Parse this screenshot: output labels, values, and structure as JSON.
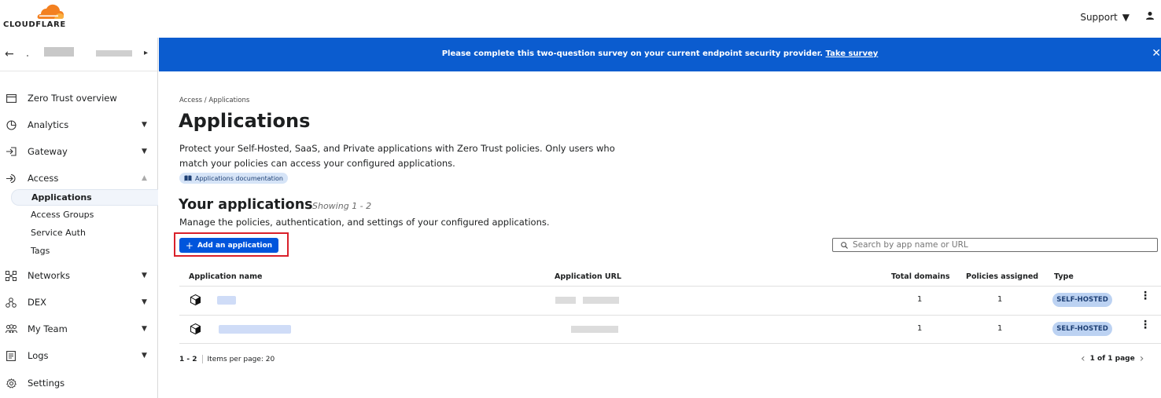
{
  "header": {
    "brand": "CLOUDFLARE",
    "support_label": "Support"
  },
  "sidebar": {
    "items": [
      {
        "label": "Zero Trust overview",
        "icon": "window-icon"
      },
      {
        "label": "Analytics",
        "icon": "pie-chart-icon"
      },
      {
        "label": "Gateway",
        "icon": "gateway-icon"
      },
      {
        "label": "Access",
        "icon": "access-icon"
      },
      {
        "label": "Networks",
        "icon": "network-icon"
      },
      {
        "label": "DEX",
        "icon": "dex-icon"
      },
      {
        "label": "My Team",
        "icon": "team-icon"
      },
      {
        "label": "Logs",
        "icon": "logs-icon"
      },
      {
        "label": "Settings",
        "icon": "gear-icon"
      }
    ],
    "access_subitems": [
      "Applications",
      "Access Groups",
      "Service Auth",
      "Tags"
    ]
  },
  "banner": {
    "text": "Please complete this two-question survey on your current endpoint security provider.",
    "link": "Take survey",
    "color": "#0b5ccf"
  },
  "main": {
    "breadcrumb": "Access / Applications",
    "title": "Applications",
    "description": "Protect your Self-Hosted, SaaS, and Private applications with Zero Trust policies. Only users who match your policies can access your configured applications.",
    "doc_link": "Applications documentation",
    "section_title": "Your applications",
    "showing": "Showing 1 - 2",
    "section_description": "Manage the policies, authentication, and settings of your configured applications.",
    "add_button": "Add an application",
    "search_placeholder": "Search by app name or URL"
  },
  "table": {
    "columns": [
      "Application name",
      "Application URL",
      "Total domains",
      "Policies assigned",
      "Type"
    ],
    "rows": [
      {
        "total_domains": "1",
        "policies_assigned": "1",
        "type": "SELF-HOSTED"
      },
      {
        "total_domains": "1",
        "policies_assigned": "1",
        "type": "SELF-HOSTED"
      }
    ]
  },
  "pagination": {
    "range": "1 - 2",
    "items_per_page": "Items per page: 20",
    "page_info": "1 of 1 page"
  },
  "colors": {
    "accent": "#0055dc",
    "brand_orange": "#f38020",
    "highlight": "#d9202a"
  }
}
